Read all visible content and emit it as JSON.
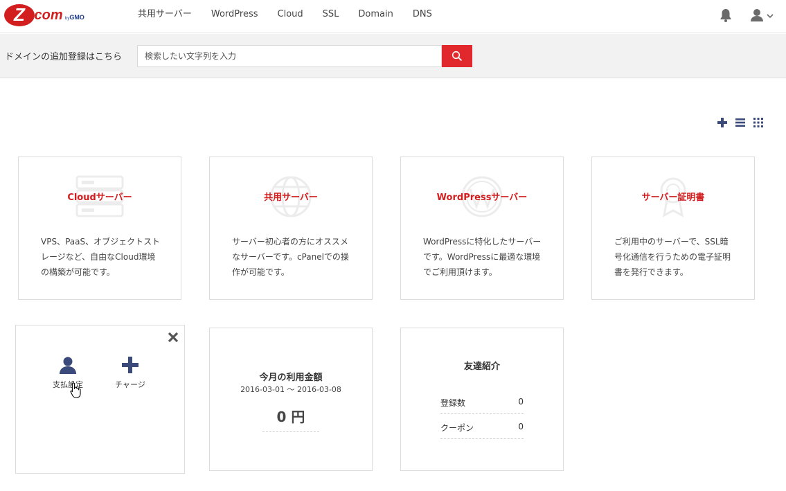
{
  "logo": {
    "letter": "Z",
    "dot": ".com",
    "by": "by",
    "gmo": "GMO"
  },
  "nav": {
    "items": [
      {
        "label": "共用サーバー"
      },
      {
        "label": "WordPress"
      },
      {
        "label": "Cloud"
      },
      {
        "label": "SSL"
      },
      {
        "label": "Domain"
      },
      {
        "label": "DNS"
      }
    ]
  },
  "header_icons": {
    "notifications": "bell-icon",
    "account": "user-icon",
    "account_menu": "chevron-down-icon"
  },
  "search": {
    "label": "ドメインの追加登録はこちら",
    "placeholder": "検索したい文字列を入力",
    "button_icon": "search-icon"
  },
  "view_controls": {
    "add": "plus-icon",
    "list": "list-icon",
    "grid": "grid-icon"
  },
  "services": [
    {
      "title": "Cloudサーバー",
      "icon": "server-icon",
      "description": "VPS、PaaS、オブジェクトストレージなど、自由なCloud環境の構築が可能です。"
    },
    {
      "title": "共用サーバー",
      "icon": "globe-icon",
      "description": "サーバー初心者の方にオススメなサーバーです。cPanelでの操作が可能です。"
    },
    {
      "title": "WordPressサーバー",
      "icon": "wordpress-icon",
      "description": "WordPressに特化したサーバーです。WordPressに最適な環境でご利用頂けます。"
    },
    {
      "title": "サーバー証明書",
      "icon": "certificate-icon",
      "description": "ご利用中のサーバーで、SSL暗号化通信を行うための電子証明書を発行できます。"
    }
  ],
  "quick_actions": {
    "close_icon": "close-icon",
    "payment_label": "支払設定",
    "charge_label": "チャージ"
  },
  "usage": {
    "title": "今月の利用金額",
    "range": "2016-03-01 ～ 2016-03-08",
    "amount": "0 円"
  },
  "referral": {
    "title": "友達紹介",
    "rows": [
      {
        "label": "登録数",
        "value": "0"
      },
      {
        "label": "クーポン",
        "value": "0"
      }
    ]
  },
  "colors": {
    "brand_red": "#d21e1e",
    "accent_navy": "#3a4a7a",
    "search_button": "#e0282d"
  }
}
